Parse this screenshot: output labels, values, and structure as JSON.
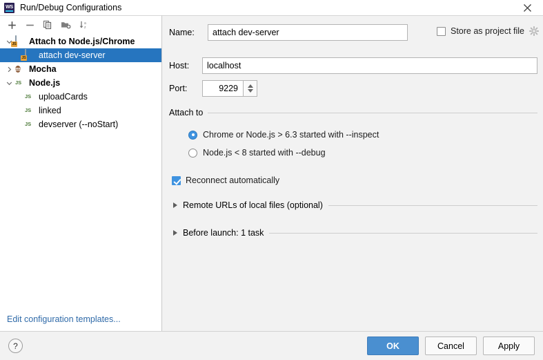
{
  "window": {
    "title": "Run/Debug Configurations",
    "app_icon": "webstorm-logo-icon",
    "close_icon": "close-icon"
  },
  "left_panel": {
    "toolbar": [
      {
        "name": "add-configuration-button",
        "icon": "plus-icon",
        "label": "+"
      },
      {
        "name": "remove-configuration-button",
        "icon": "minus-icon",
        "label": "–"
      },
      {
        "name": "copy-configuration-button",
        "icon": "copy-icon",
        "label": "Copy"
      },
      {
        "name": "add-folder-button",
        "icon": "folder-add-icon",
        "label": "New Folder"
      },
      {
        "name": "sort-configurations-button",
        "icon": "sort-alphabetically-icon",
        "label": "Sort"
      }
    ],
    "tree": [
      {
        "label": "Attach to Node.js/Chrome",
        "icon": "js-attach-icon",
        "expanded": true,
        "level": 0,
        "bold": true,
        "selected": false,
        "has_twisty": true
      },
      {
        "label": "attach dev-server",
        "icon": "js-attach-icon",
        "expanded": null,
        "level": 1,
        "bold": false,
        "selected": true,
        "has_twisty": false
      },
      {
        "label": "Mocha",
        "icon": "mocha-icon",
        "expanded": false,
        "level": 0,
        "bold": true,
        "selected": false,
        "has_twisty": true
      },
      {
        "label": "Node.js",
        "icon": "nodejs-icon",
        "expanded": true,
        "level": 0,
        "bold": true,
        "selected": false,
        "has_twisty": true
      },
      {
        "label": "uploadCards",
        "icon": "nodejs-icon",
        "expanded": null,
        "level": 1,
        "bold": false,
        "selected": false,
        "has_twisty": false
      },
      {
        "label": "linked",
        "icon": "nodejs-icon",
        "expanded": null,
        "level": 1,
        "bold": false,
        "selected": false,
        "has_twisty": false
      },
      {
        "label": "devserver (--noStart)",
        "icon": "nodejs-icon",
        "expanded": null,
        "level": 1,
        "bold": false,
        "selected": false,
        "has_twisty": false
      }
    ],
    "edit_templates_link": "Edit configuration templates..."
  },
  "form": {
    "name_label": "Name:",
    "name_value": "attach dev-server",
    "name_placeholder": "",
    "store_as_project_file_label": "Store as project file",
    "store_as_project_file_checked": false,
    "store_settings_icon": "gear-icon",
    "host_label": "Host:",
    "host_value": "localhost",
    "host_placeholder": "",
    "port_label": "Port:",
    "port_value": "9229",
    "attach_to_group_title": "Attach to",
    "attach_options": [
      {
        "label": "Chrome or Node.js > 6.3 started with --inspect",
        "selected": true
      },
      {
        "label": "Node.js < 8 started with --debug",
        "selected": false
      }
    ],
    "reconnect_label": "Reconnect automatically",
    "reconnect_checked": true,
    "sections": [
      {
        "title": "Remote URLs of local files (optional)",
        "expanded": false
      },
      {
        "title": "Before launch: 1 task",
        "expanded": false
      }
    ]
  },
  "footer": {
    "help_label": "?",
    "ok_label": "OK",
    "cancel_label": "Cancel",
    "apply_label": "Apply"
  },
  "colors": {
    "accent_blue": "#4a8fd0",
    "selection_blue": "#2675bf",
    "link_blue": "#2f6aa8",
    "panel_gray": "#f2f2f2",
    "nodejs_green": "#6aa84f",
    "mocha_brown": "#8a5a38",
    "js_badge_orange": "#e8a33d"
  }
}
